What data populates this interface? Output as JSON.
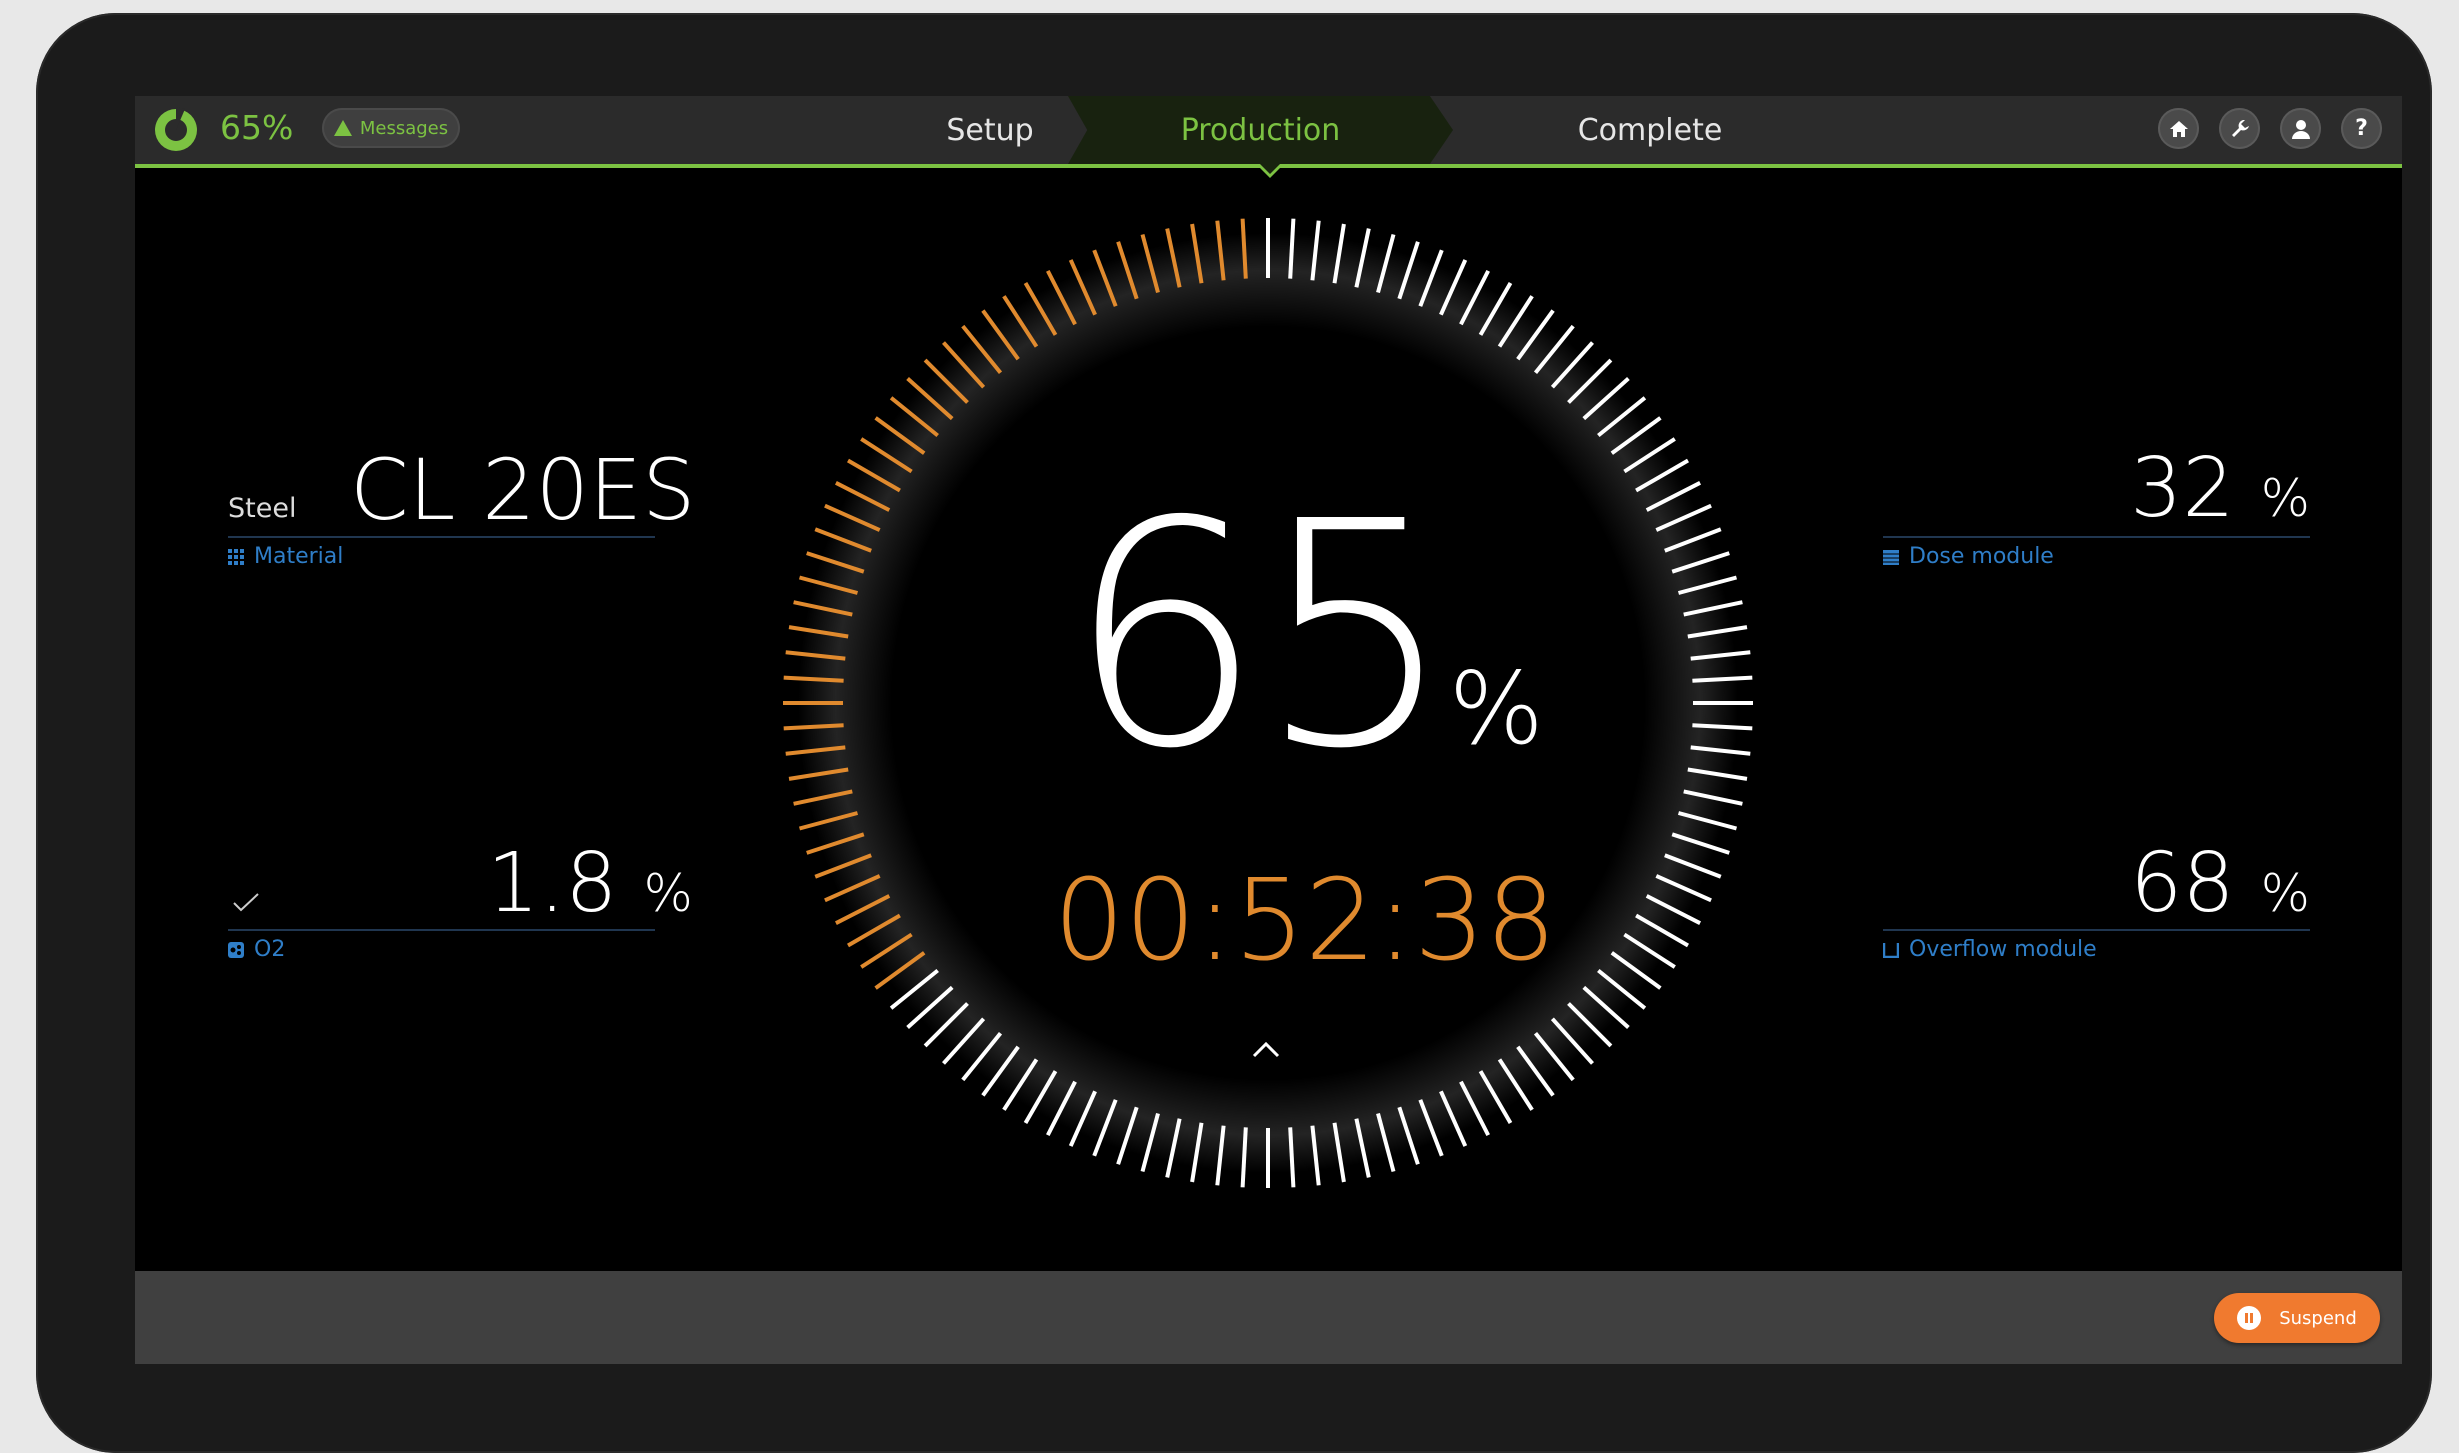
{
  "header": {
    "progress_percent": "65%",
    "messages_label": "Messages",
    "steps": [
      {
        "label": "Setup",
        "state": "done"
      },
      {
        "label": "Production",
        "state": "active"
      },
      {
        "label": "Complete",
        "state": "pending"
      }
    ],
    "icons": [
      "home-icon",
      "wrench-icon",
      "user-icon",
      "help-icon"
    ],
    "help_glyph": "?"
  },
  "left": {
    "material": {
      "prefix": "Steel",
      "value": "CL 20ES",
      "caption": "Material"
    },
    "o2": {
      "value": "1.8",
      "unit": "%",
      "caption": "O2"
    }
  },
  "right": {
    "dose": {
      "value": "32",
      "unit": "%",
      "caption": "Dose module"
    },
    "overflow": {
      "value": "68",
      "unit": "%",
      "caption": "Overflow module"
    }
  },
  "center": {
    "percent": "65",
    "unit": "%",
    "timer": "00:52:38",
    "progress": 0.65
  },
  "footer": {
    "suspend_label": "Suspend"
  },
  "colors": {
    "accent_green": "#7cc242",
    "accent_orange": "#e08a2e",
    "caption_blue": "#2f7ec8"
  }
}
